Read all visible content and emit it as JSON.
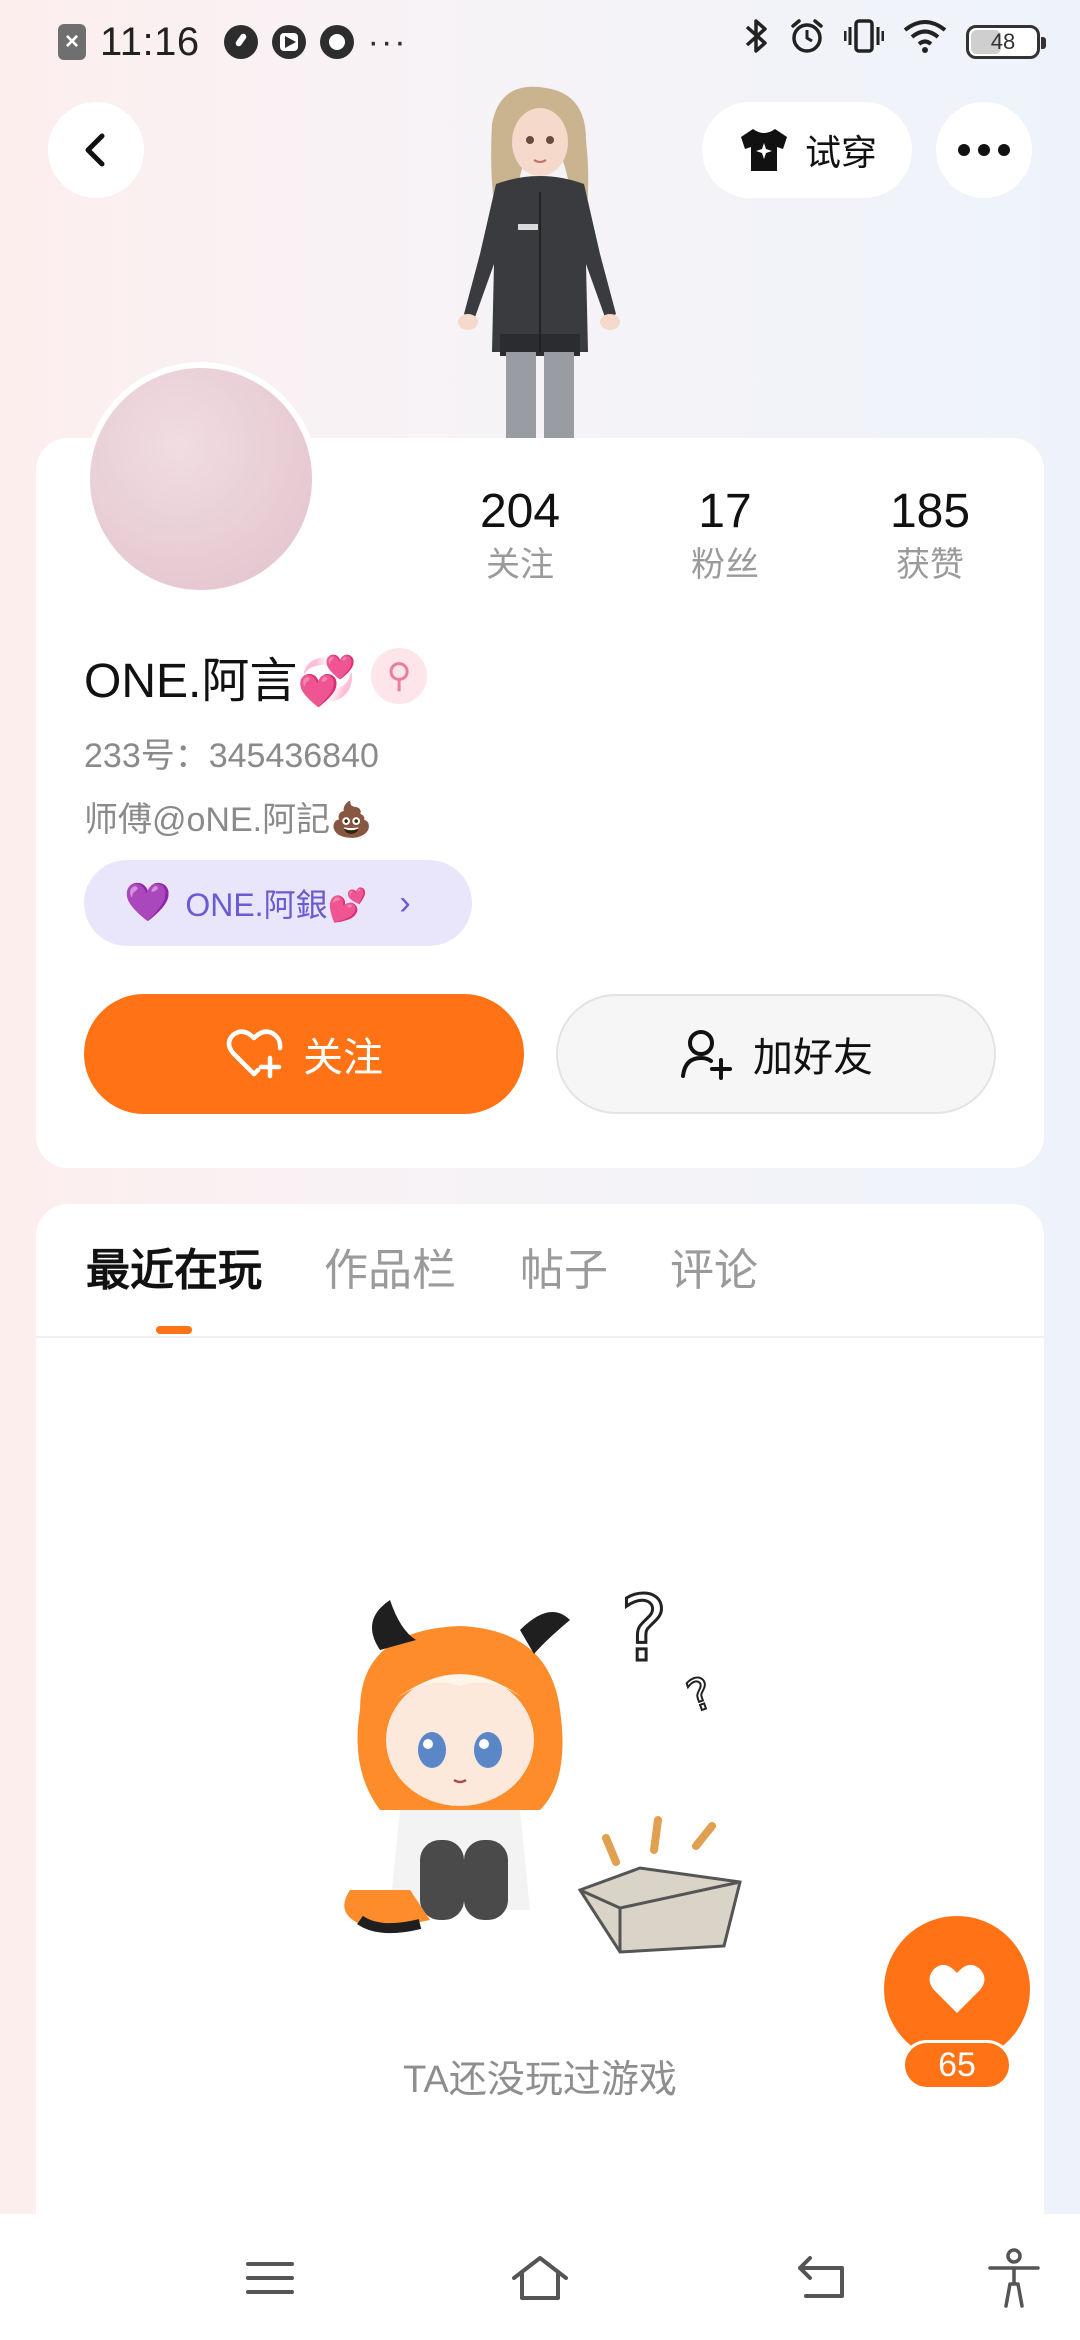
{
  "status_bar": {
    "time": "11:16",
    "dots": "···",
    "battery": "48"
  },
  "header": {
    "try_on_label": "试穿"
  },
  "profile": {
    "nickname": "ONE.阿言💞",
    "gender_symbol": "⚲",
    "uid": "233号：345436840",
    "master": "师傅@oNE.阿記💩",
    "relation_heart": "💜",
    "relation_name": "ONE.阿銀💕",
    "relation_arrow": "›",
    "stats": [
      {
        "value": "204",
        "label": "关注"
      },
      {
        "value": "17",
        "label": "粉丝"
      },
      {
        "value": "185",
        "label": "获赞"
      }
    ],
    "follow_label": "关注",
    "add_friend_label": "加好友"
  },
  "tabs": [
    {
      "label": "最近在玩",
      "active": true
    },
    {
      "label": "作品栏",
      "active": false
    },
    {
      "label": "帖子",
      "active": false
    },
    {
      "label": "评论",
      "active": false
    }
  ],
  "empty_state": {
    "text": "TA还没玩过游戏"
  },
  "like_float": {
    "count": "65"
  },
  "colors": {
    "accent": "#ff7216",
    "relation_bg": "#e9e6fb",
    "relation_text": "#6a5bd3",
    "muted_text": "#8a8a8a"
  },
  "icons": {
    "back": "chevron-left-icon",
    "try_on": "tshirt-sparkle-icon",
    "more": "more-dots-icon",
    "follow": "heart-plus-icon",
    "add_friend": "user-plus-icon",
    "like": "heart-icon",
    "nav": [
      "menu-icon",
      "home-icon",
      "back-icon",
      "accessibility-icon"
    ]
  }
}
